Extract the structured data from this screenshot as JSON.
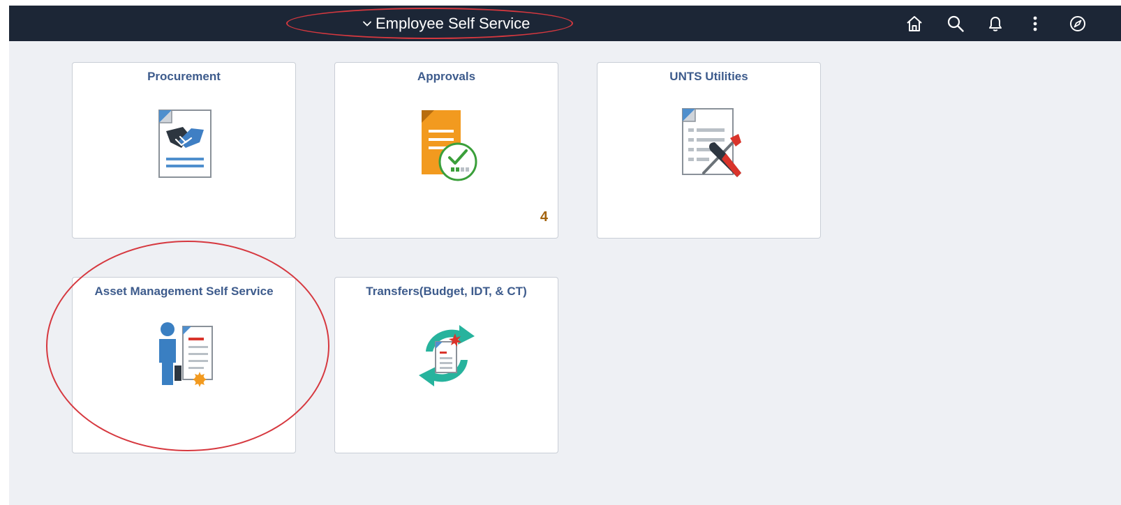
{
  "header": {
    "homepage_title": "Employee Self Service",
    "icons": [
      "home-icon",
      "search-icon",
      "notifications-bell-icon",
      "actions-menu-icon",
      "navbar-compass-icon"
    ]
  },
  "tiles": [
    {
      "title": "Procurement",
      "icon": "procurement-handshake-icon"
    },
    {
      "title": "Approvals",
      "icon": "approvals-document-check-icon",
      "count": "4"
    },
    {
      "title": "UNTS Utilities",
      "icon": "utilities-document-tools-icon"
    },
    {
      "title": "Asset Management Self Service",
      "icon": "asset-management-person-certificate-icon"
    },
    {
      "title": "Transfers(Budget, IDT, & CT)",
      "icon": "transfers-cycle-document-icon"
    }
  ],
  "colors": {
    "topbar": "#1c2636",
    "page_background": "#eef0f4",
    "tile_title": "#3d5b8c",
    "count_badge": "#a3630e",
    "annotation": "#d6383f"
  }
}
